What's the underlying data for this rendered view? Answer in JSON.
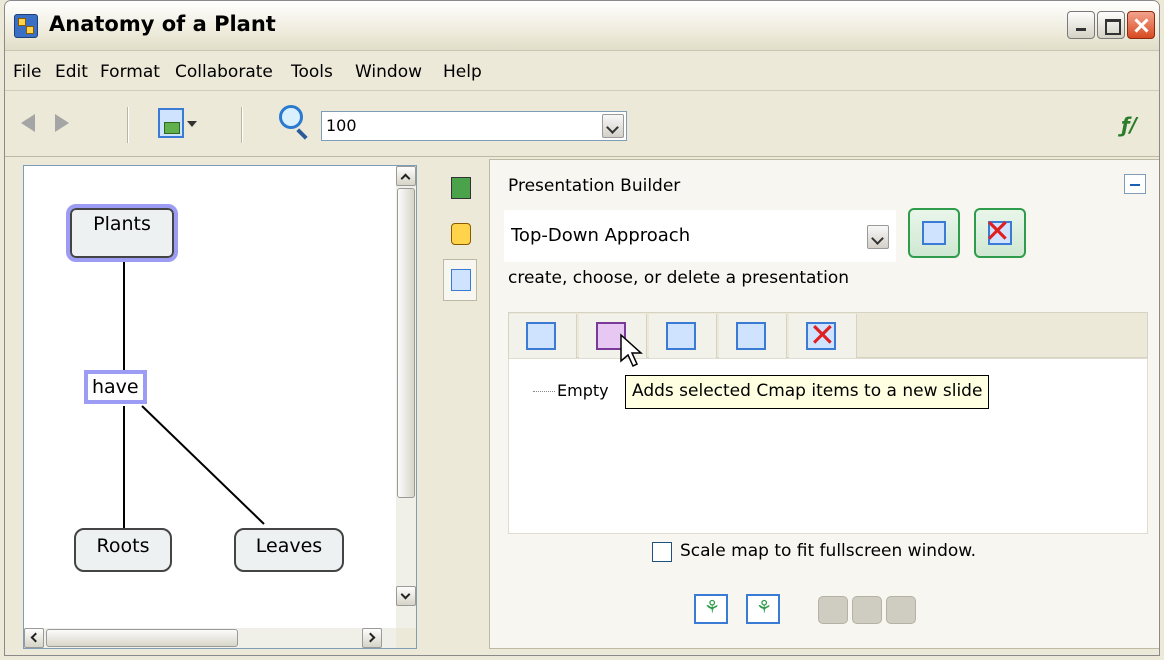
{
  "window": {
    "title": "Anatomy of a Plant"
  },
  "menu": {
    "items": [
      "File",
      "Edit",
      "Format",
      "Collaborate",
      "Tools",
      "Window",
      "Help"
    ]
  },
  "toolbar": {
    "zoom_value": "100",
    "icons": [
      "back-arrow-icon",
      "forward-arrow-icon",
      "views-icon",
      "zoom-icon",
      "edit-tool-icon"
    ]
  },
  "cmap": {
    "concepts": [
      "Plants",
      "Roots",
      "Leaves"
    ],
    "linking_phrase": "have",
    "links": [
      {
        "from": "Plants",
        "to": "have"
      },
      {
        "from": "have",
        "to": "Roots"
      },
      {
        "from": "have",
        "to": "Leaves"
      }
    ]
  },
  "presentation_builder": {
    "title": "Presentation Builder",
    "selected_presentation": "Top-Down Approach",
    "hint": "create, choose, or delete a presentation",
    "slide_tree_label": "Empty",
    "tooltip": "Adds selected Cmap items to a new slide",
    "scale_checkbox_label": "Scale map to fit fullscreen window.",
    "scale_checked": false
  },
  "colors": {
    "selection_outline": "#9c9cf4",
    "accent_green": "#2f9c4b",
    "accent_blue": "#3a7bd5",
    "delete_red": "#e02020"
  }
}
